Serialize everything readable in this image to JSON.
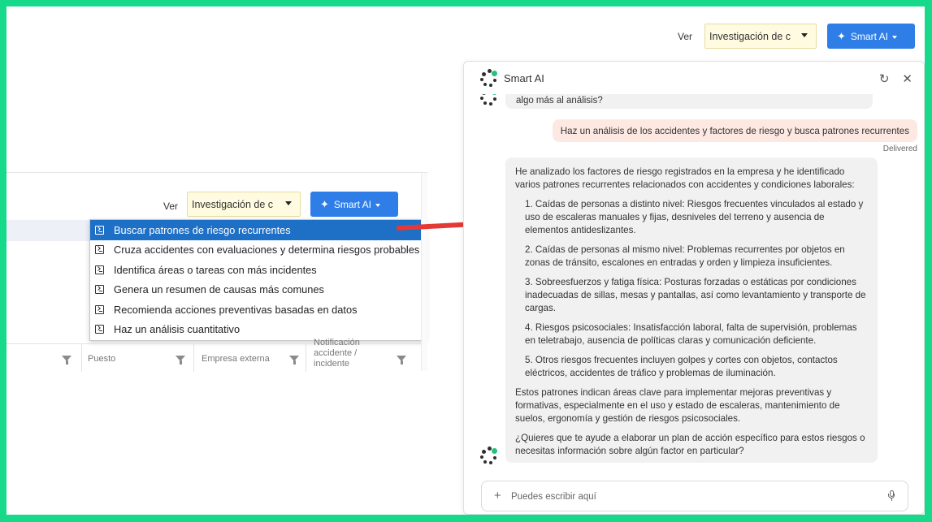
{
  "top_bar": {
    "view_label": "Ver",
    "view_select_value": "Investigación de c",
    "smart_ai_button": "Smart AI"
  },
  "left_panel": {
    "view_label": "Ver",
    "view_select_value": "Investigación de c",
    "smart_ai_button": "Smart AI",
    "dropdown_items": [
      "Buscar patrones de riesgo recurrentes",
      "Cruza accidentes con evaluaciones y determina riesgos probables",
      "Identifica áreas o tareas con más incidentes",
      "Genera un resumen de causas más comunes",
      "Recomienda acciones preventivas basadas en datos",
      "Haz un análisis cuantitativo"
    ],
    "selected_index": 0,
    "grid_headers": [
      "Puesto",
      "Empresa externa",
      "Notificación accidente / incidente"
    ]
  },
  "ai_panel": {
    "title": "Smart AI",
    "prev_message_tail": "algo más al análisis?",
    "user_message": "Haz un análisis de los accidentes y factores de riesgo y busca patrones recurrentes",
    "status": "Delivered",
    "bot_message": {
      "intro": "He analizado los factores de riesgo registrados en la empresa y he identificado varios patrones recurrentes relacionados con accidentes y condiciones laborales:",
      "items": [
        "1. Caídas de personas a distinto nivel: Riesgos frecuentes vinculados al estado y uso de escaleras manuales y fijas, desniveles del terreno y ausencia de elementos antideslizantes.",
        "2. Caídas de personas al mismo nivel: Problemas recurrentes por objetos en zonas de tránsito, escalones en entradas y orden y limpieza insuficientes.",
        "3. Sobreesfuerzos y fatiga física: Posturas forzadas o estáticas por condiciones inadecuadas de sillas, mesas y pantallas, así como levantamiento y transporte de cargas.",
        "4. Riesgos psicosociales: Insatisfacción laboral, falta de supervisión, problemas en teletrabajo, ausencia de políticas claras y comunicación deficiente.",
        "5. Otros riesgos frecuentes incluyen golpes y cortes con objetos, contactos eléctricos, accidentes de tráfico y problemas de iluminación."
      ],
      "summary": "Estos patrones indican áreas clave para implementar mejoras preventivas y formativas, especialmente en el uso y estado de escaleras, mantenimiento de suelos, ergonomía y gestión de riesgos psicosociales.",
      "question": "¿Quieres que te ayude a elaborar un plan de acción específico para estos riesgos o necesitas información sobre algún factor en particular?"
    },
    "input_placeholder": "Puedes escribir aquí",
    "stray_char": "C"
  },
  "colors": {
    "frame_border": "#17d98a",
    "accent_blue": "#2f7ee8",
    "selected_item": "#1e6fc6",
    "user_bubble": "#fde9e1",
    "bot_bubble": "#f1f1f1",
    "arrow": "#e53935",
    "select_bg": "#fffbe0"
  },
  "icons": [
    "sparkle-icon",
    "terminal-icon",
    "filter-icon",
    "refresh-icon",
    "close-icon",
    "plus-icon",
    "mic-icon",
    "smart-ai-logo-icon",
    "arrow-icon"
  ]
}
